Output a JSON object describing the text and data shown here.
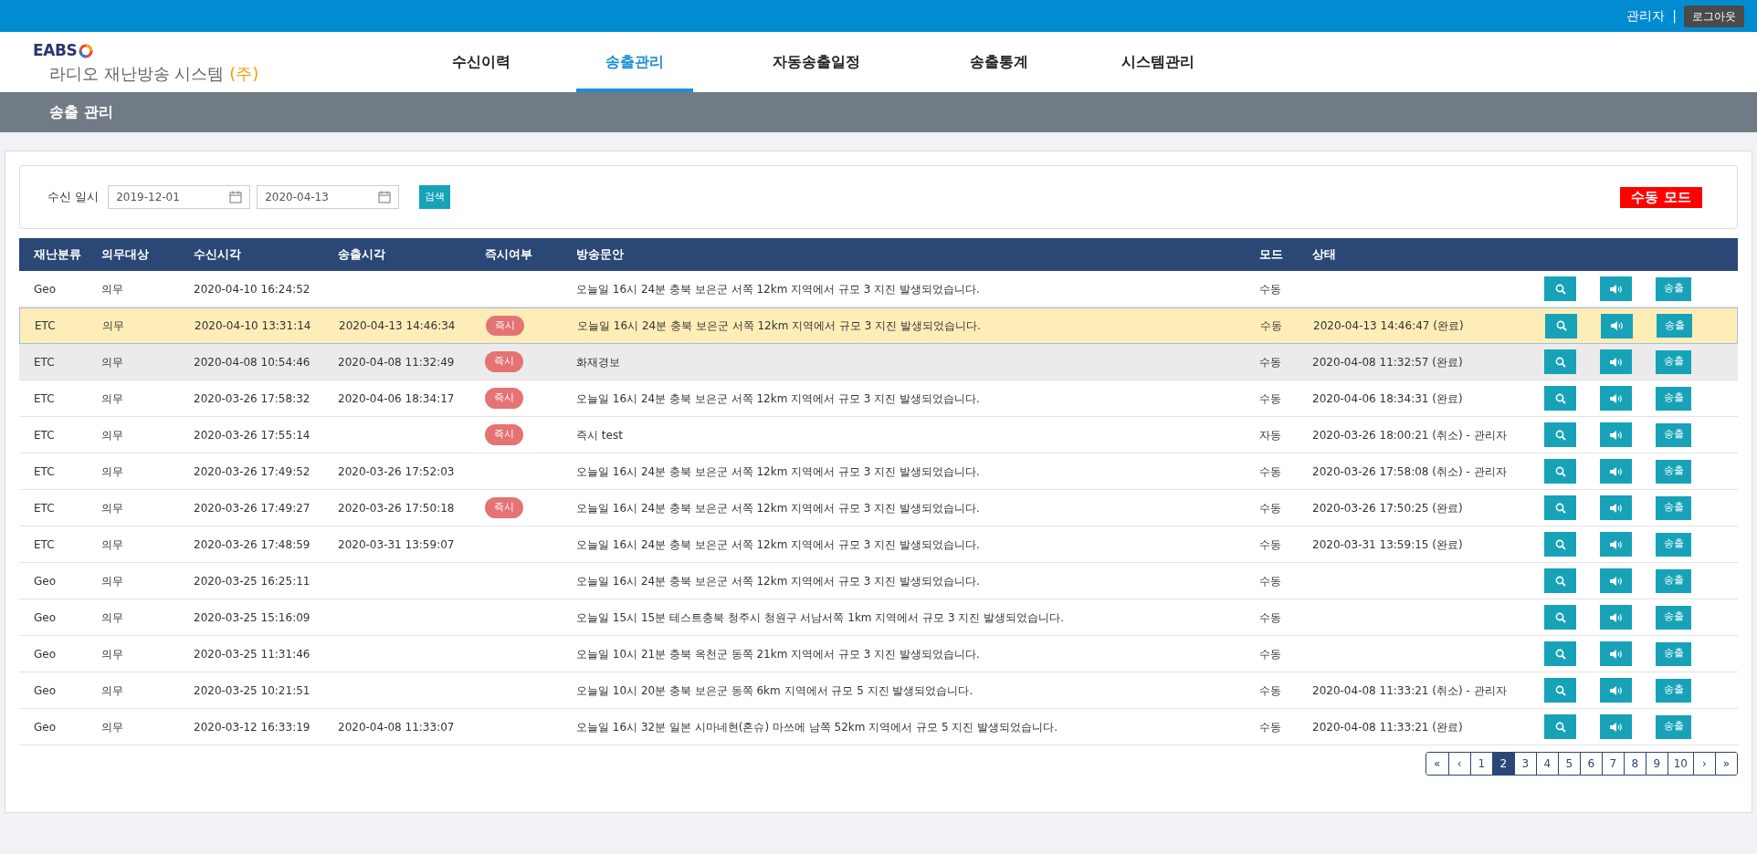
{
  "top_bar": {
    "user": "관리자",
    "separator": "|",
    "logout": "로그아웃"
  },
  "logo": {
    "brand": "EABS",
    "subtitle": "라디오 재난방송 시스템 ",
    "subtitle_mark": "(주)"
  },
  "nav": [
    {
      "label": "수신이력",
      "selected": false
    },
    {
      "label": "송출관리",
      "selected": true
    },
    {
      "label": "자동송출일정",
      "selected": false
    },
    {
      "label": "송출통계",
      "selected": false
    },
    {
      "label": "시스템관리",
      "selected": false
    }
  ],
  "page_title": "송출 관리",
  "filter": {
    "label": "수신 일시",
    "date_from": "2019-12-01",
    "date_to": "2020-04-13",
    "search": "검색",
    "mode_badge": "수동 모드"
  },
  "table": {
    "columns": [
      "재난분류",
      "의무대상",
      "수신시각",
      "송출시각",
      "즉시여부",
      "방송문안",
      "모드",
      "상태"
    ],
    "rows": [
      {
        "category": "Geo",
        "target": "의무",
        "received": "2020-04-10 16:24:52",
        "sent": "",
        "instant": null,
        "message": "오늘일 16시 24분 충북 보은군 서쪽 12km 지역에서 규모 3 지진 발생되었습니다.",
        "mode": "수동",
        "status": "",
        "selected": false,
        "hovered": false,
        "send": "송출"
      },
      {
        "category": "ETC",
        "target": "의무",
        "received": "2020-04-10 13:31:14",
        "sent": "2020-04-13 14:46:34",
        "instant": "즉시",
        "message": "오늘일 16시 24분 충북 보은군 서쪽 12km 지역에서 규모 3 지진 발생되었습니다.",
        "mode": "수동",
        "status": "2020-04-13 14:46:47 (완료)",
        "selected": true,
        "hovered": false,
        "send": "송출"
      },
      {
        "category": "ETC",
        "target": "의무",
        "received": "2020-04-08 10:54:46",
        "sent": "2020-04-08 11:32:49",
        "instant": "즉시",
        "message": "화재경보",
        "mode": "수동",
        "status": "2020-04-08 11:32:57 (완료)",
        "selected": false,
        "hovered": true,
        "send": "송출"
      },
      {
        "category": "ETC",
        "target": "의무",
        "received": "2020-03-26 17:58:32",
        "sent": "2020-04-06 18:34:17",
        "instant": "즉시",
        "message": "오늘일 16시 24분 충북 보은군 서쪽 12km 지역에서 규모 3 지진 발생되었습니다.",
        "mode": "수동",
        "status": "2020-04-06 18:34:31 (완료)",
        "selected": false,
        "hovered": false,
        "send": "송출"
      },
      {
        "category": "ETC",
        "target": "의무",
        "received": "2020-03-26 17:55:14",
        "sent": "",
        "instant": "즉시",
        "message": "즉시 test",
        "mode": "자동",
        "status": "2020-03-26 18:00:21 (취소) - 관리자",
        "selected": false,
        "hovered": false,
        "send": "송출"
      },
      {
        "category": "ETC",
        "target": "의무",
        "received": "2020-03-26 17:49:52",
        "sent": "2020-03-26 17:52:03",
        "instant": null,
        "message": "오늘일 16시 24분 충북 보은군 서쪽 12km 지역에서 규모 3 지진 발생되었습니다.",
        "mode": "수동",
        "status": "2020-03-26 17:58:08 (취소) - 관리자",
        "selected": false,
        "hovered": false,
        "send": "송출"
      },
      {
        "category": "ETC",
        "target": "의무",
        "received": "2020-03-26 17:49:27",
        "sent": "2020-03-26 17:50:18",
        "instant": "즉시",
        "message": "오늘일 16시 24분 충북 보은군 서쪽 12km 지역에서 규모 3 지진 발생되었습니다.",
        "mode": "수동",
        "status": "2020-03-26 17:50:25 (완료)",
        "selected": false,
        "hovered": false,
        "send": "송출"
      },
      {
        "category": "ETC",
        "target": "의무",
        "received": "2020-03-26 17:48:59",
        "sent": "2020-03-31 13:59:07",
        "instant": null,
        "message": "오늘일 16시 24분 충북 보은군 서쪽 12km 지역에서 규모 3 지진 발생되었습니다.",
        "mode": "수동",
        "status": "2020-03-31 13:59:15 (완료)",
        "selected": false,
        "hovered": false,
        "send": "송출"
      },
      {
        "category": "Geo",
        "target": "의무",
        "received": "2020-03-25 16:25:11",
        "sent": "",
        "instant": null,
        "message": "오늘일 16시 24분 충북 보은군 서쪽 12km 지역에서 규모 3 지진 발생되었습니다.",
        "mode": "수동",
        "status": "",
        "selected": false,
        "hovered": false,
        "send": "송출"
      },
      {
        "category": "Geo",
        "target": "의무",
        "received": "2020-03-25 15:16:09",
        "sent": "",
        "instant": null,
        "message": "오늘일 15시 15분 테스트충북 청주시 청원구 서남서쪽 1km 지역에서 규모 3 지진 발생되었습니다.",
        "mode": "수동",
        "status": "",
        "selected": false,
        "hovered": false,
        "send": "송출"
      },
      {
        "category": "Geo",
        "target": "의무",
        "received": "2020-03-25 11:31:46",
        "sent": "",
        "instant": null,
        "message": "오늘일 10시 21분 충북 옥천군 동쪽 21km 지역에서 규모 3 지진 발생되었습니다.",
        "mode": "수동",
        "status": "",
        "selected": false,
        "hovered": false,
        "send": "송출"
      },
      {
        "category": "Geo",
        "target": "의무",
        "received": "2020-03-25 10:21:51",
        "sent": "",
        "instant": null,
        "message": "오늘일 10시 20분 충북 보은군 동쪽 6km 지역에서 규모 5 지진 발생되었습니다.",
        "mode": "수동",
        "status": "2020-04-08 11:33:21 (취소) - 관리자",
        "selected": false,
        "hovered": false,
        "send": "송출"
      },
      {
        "category": "Geo",
        "target": "의무",
        "received": "2020-03-12 16:33:19",
        "sent": "2020-04-08 11:33:07",
        "instant": null,
        "message": "오늘일 16시 32분 일본 시마네현(혼슈) 마쓰에 남쪽 52km 지역에서 규모 5 지진 발생되었습니다.",
        "mode": "수동",
        "status": "2020-04-08 11:33:21 (완료)",
        "selected": false,
        "hovered": false,
        "send": "송출"
      }
    ]
  },
  "pagination": [
    {
      "label": "«",
      "selected": false
    },
    {
      "label": "‹",
      "selected": false
    },
    {
      "label": "1",
      "selected": false
    },
    {
      "label": "2",
      "selected": true
    },
    {
      "label": "3",
      "selected": false
    },
    {
      "label": "4",
      "selected": false
    },
    {
      "label": "5",
      "selected": false
    },
    {
      "label": "6",
      "selected": false
    },
    {
      "label": "7",
      "selected": false
    },
    {
      "label": "8",
      "selected": false
    },
    {
      "label": "9",
      "selected": false
    },
    {
      "label": "10",
      "selected": false
    },
    {
      "label": "›",
      "selected": false
    },
    {
      "label": "»",
      "selected": false
    }
  ]
}
